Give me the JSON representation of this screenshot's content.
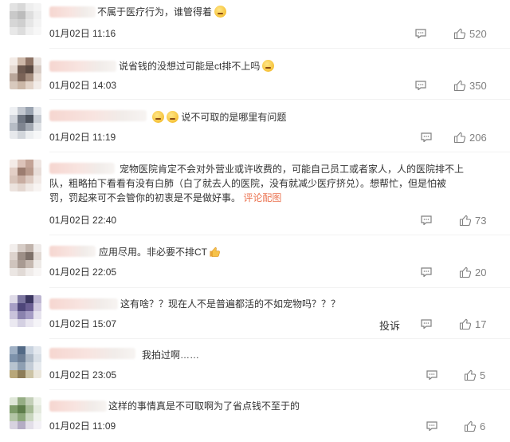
{
  "comments": [
    {
      "text": "不属于医疗行为，谁管得着",
      "emoji": "doge-emoji",
      "date": "01月02日",
      "time": "11:16",
      "likes": "520"
    },
    {
      "text": "说省钱的没想过可能是ct排不上吗",
      "emoji": "laughing-emoji",
      "date": "01月02日",
      "time": "14:03",
      "likes": "350"
    },
    {
      "text": "说不可取的是哪里有问题",
      "emoji": "smirk-emoji",
      "date": "01月02日",
      "time": "11:19",
      "likes": "206"
    },
    {
      "text": "宠物医院肯定不会对外营业或许收费的，可能自己员工或者家人，人的医院排不上队，粗略拍下看看有没有白肺（白了就去人的医院，没有就减少医疗挤兑）。想帮忙，但是怕被罚，罚起来可不会管你的初衷是不是做好事。",
      "link": "评论配图",
      "date": "01月02日",
      "time": "22:40",
      "likes": "73"
    },
    {
      "text": "应用尽用。非必要不排CT",
      "emoji": "thumbs-up-emoji",
      "date": "01月02日",
      "time": "22:05",
      "likes": "20"
    },
    {
      "text": "这有啥？？现在人不是普遍都活的不如宠物吗？？？",
      "date": "01月02日",
      "time": "15:07",
      "report": "投诉",
      "likes": "17"
    },
    {
      "text": "我拍过啊……",
      "date": "01月02日",
      "time": "23:05",
      "likes": "5"
    },
    {
      "text": "这样的事情真是不可取啊为了省点钱不至于的",
      "date": "01月02日",
      "time": "11:09",
      "likes": "6"
    }
  ],
  "colors": {
    "text": "#333333",
    "muted": "#808080",
    "link": "#eb7350",
    "divider": "#f2f2f2"
  },
  "icons": {
    "reply": "comment-icon",
    "like": "thumbs-up-icon"
  }
}
